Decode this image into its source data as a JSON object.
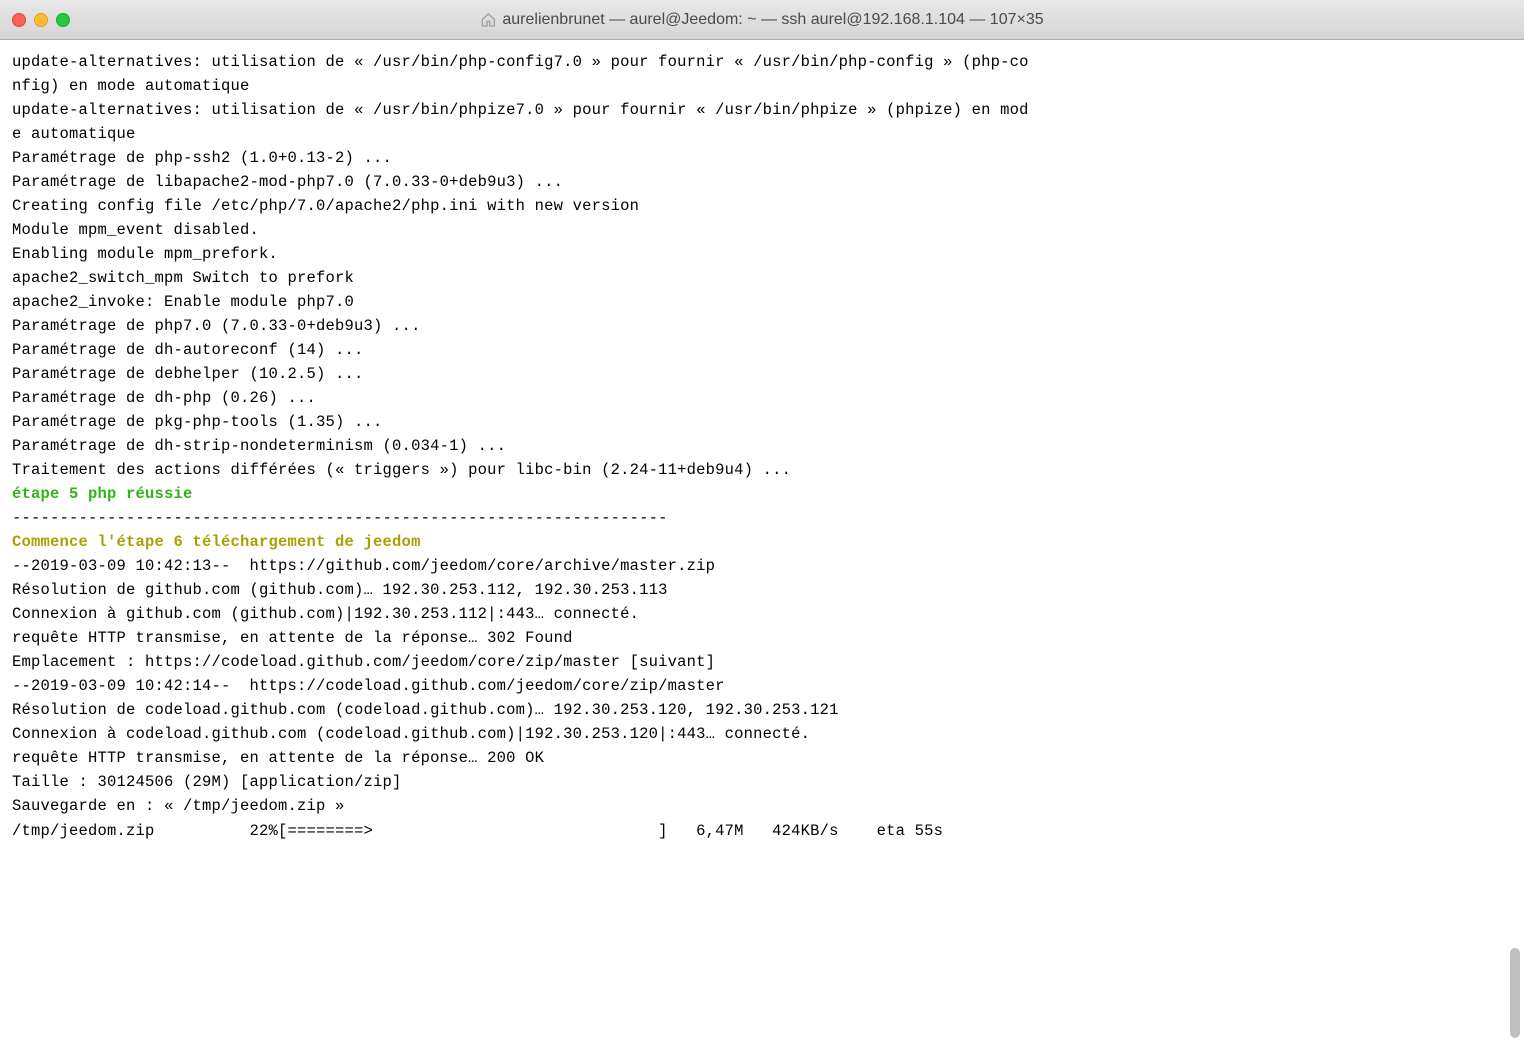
{
  "window": {
    "title": "aurelienbrunet — aurel@Jeedom: ~ — ssh aurel@192.168.1.104 — 107×35"
  },
  "colors": {
    "green": "#2fb517",
    "olive": "#a8a200"
  },
  "lines": [
    {
      "style": "plain",
      "text": "update-alternatives: utilisation de « /usr/bin/php-config7.0 » pour fournir « /usr/bin/php-config » (php-co"
    },
    {
      "style": "plain",
      "text": "nfig) en mode automatique"
    },
    {
      "style": "plain",
      "text": "update-alternatives: utilisation de « /usr/bin/phpize7.0 » pour fournir « /usr/bin/phpize » (phpize) en mod"
    },
    {
      "style": "plain",
      "text": "e automatique"
    },
    {
      "style": "plain",
      "text": "Paramétrage de php-ssh2 (1.0+0.13-2) ..."
    },
    {
      "style": "plain",
      "text": "Paramétrage de libapache2-mod-php7.0 (7.0.33-0+deb9u3) ..."
    },
    {
      "style": "plain",
      "text": ""
    },
    {
      "style": "plain",
      "text": "Creating config file /etc/php/7.0/apache2/php.ini with new version"
    },
    {
      "style": "plain",
      "text": "Module mpm_event disabled."
    },
    {
      "style": "plain",
      "text": "Enabling module mpm_prefork."
    },
    {
      "style": "plain",
      "text": "apache2_switch_mpm Switch to prefork"
    },
    {
      "style": "plain",
      "text": "apache2_invoke: Enable module php7.0"
    },
    {
      "style": "plain",
      "text": "Paramétrage de php7.0 (7.0.33-0+deb9u3) ..."
    },
    {
      "style": "plain",
      "text": "Paramétrage de dh-autoreconf (14) ..."
    },
    {
      "style": "plain",
      "text": "Paramétrage de debhelper (10.2.5) ..."
    },
    {
      "style": "plain",
      "text": "Paramétrage de dh-php (0.26) ..."
    },
    {
      "style": "plain",
      "text": "Paramétrage de pkg-php-tools (1.35) ..."
    },
    {
      "style": "plain",
      "text": "Paramétrage de dh-strip-nondeterminism (0.034-1) ..."
    },
    {
      "style": "plain",
      "text": "Traitement des actions différées (« triggers ») pour libc-bin (2.24-11+deb9u4) ..."
    },
    {
      "style": "green",
      "text": "étape 5 php réussie"
    },
    {
      "style": "plain",
      "text": "---------------------------------------------------------------------"
    },
    {
      "style": "olive",
      "text": "Commence l'étape 6 téléchargement de jeedom"
    },
    {
      "style": "plain",
      "text": "--2019-03-09 10:42:13--  https://github.com/jeedom/core/archive/master.zip"
    },
    {
      "style": "plain",
      "text": "Résolution de github.com (github.com)… 192.30.253.112, 192.30.253.113"
    },
    {
      "style": "plain",
      "text": "Connexion à github.com (github.com)|192.30.253.112|:443… connecté."
    },
    {
      "style": "plain",
      "text": "requête HTTP transmise, en attente de la réponse… 302 Found"
    },
    {
      "style": "plain",
      "text": "Emplacement : https://codeload.github.com/jeedom/core/zip/master [suivant]"
    },
    {
      "style": "plain",
      "text": "--2019-03-09 10:42:14--  https://codeload.github.com/jeedom/core/zip/master"
    },
    {
      "style": "plain",
      "text": "Résolution de codeload.github.com (codeload.github.com)… 192.30.253.120, 192.30.253.121"
    },
    {
      "style": "plain",
      "text": "Connexion à codeload.github.com (codeload.github.com)|192.30.253.120|:443… connecté."
    },
    {
      "style": "plain",
      "text": "requête HTTP transmise, en attente de la réponse… 200 OK"
    },
    {
      "style": "plain",
      "text": "Taille : 30124506 (29M) [application/zip]"
    },
    {
      "style": "plain",
      "text": "Sauvegarde en : « /tmp/jeedom.zip »"
    },
    {
      "style": "plain",
      "text": ""
    },
    {
      "style": "plain",
      "text": "/tmp/jeedom.zip          22%[========>                              ]   6,47M   424KB/s    eta 55s"
    }
  ]
}
